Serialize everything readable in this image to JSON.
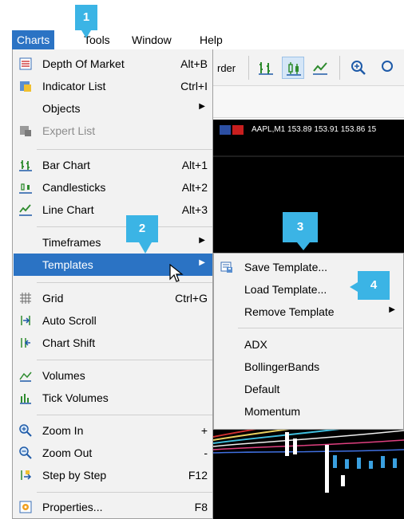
{
  "menubar": {
    "items": [
      "Charts",
      "Tools",
      "Window",
      "Help"
    ]
  },
  "toolbar": {
    "partial_label": "rder"
  },
  "chart": {
    "title": "AAPL,M1  153.89 153.91 153.86 15"
  },
  "charts_menu": {
    "items": [
      {
        "label": "Depth Of Market",
        "shortcut": "Alt+B",
        "icon": "depth-of-market-icon"
      },
      {
        "label": "Indicator List",
        "shortcut": "Ctrl+I",
        "icon": "indicator-list-icon"
      },
      {
        "label": "Objects",
        "submenu": true
      },
      {
        "label": "Expert List",
        "icon": "expert-list-icon",
        "disabled": true
      },
      {
        "label": "Bar Chart",
        "shortcut": "Alt+1",
        "icon": "bar-chart-icon"
      },
      {
        "label": "Candlesticks",
        "shortcut": "Alt+2",
        "icon": "candlesticks-icon"
      },
      {
        "label": "Line Chart",
        "shortcut": "Alt+3",
        "icon": "line-chart-icon"
      },
      {
        "label": "Timeframes",
        "submenu": true
      },
      {
        "label": "Templates",
        "submenu": true,
        "highlighted": true
      },
      {
        "label": "Grid",
        "shortcut": "Ctrl+G",
        "icon": "grid-icon"
      },
      {
        "label": "Auto Scroll",
        "icon": "auto-scroll-icon"
      },
      {
        "label": "Chart Shift",
        "icon": "chart-shift-icon"
      },
      {
        "label": "Volumes",
        "icon": "volumes-icon"
      },
      {
        "label": "Tick Volumes",
        "icon": "tick-volumes-icon"
      },
      {
        "label": "Zoom In",
        "shortcut": "+",
        "icon": "zoom-in-icon"
      },
      {
        "label": "Zoom Out",
        "shortcut": "-",
        "icon": "zoom-out-icon"
      },
      {
        "label": "Step by Step",
        "shortcut": "F12",
        "icon": "step-by-step-icon"
      },
      {
        "label": "Properties...",
        "shortcut": "F8",
        "icon": "properties-icon"
      }
    ]
  },
  "templates_menu": {
    "items": [
      {
        "label": "Save Template...",
        "icon": "save-template-icon"
      },
      {
        "label": "Load Template..."
      },
      {
        "label": "Remove Template",
        "submenu": true
      },
      {
        "label": "ADX"
      },
      {
        "label": "BollingerBands"
      },
      {
        "label": "Default"
      },
      {
        "label": "Momentum"
      }
    ]
  },
  "callouts": [
    "1",
    "2",
    "3",
    "4"
  ],
  "colors": {
    "highlight": "#2b73c4",
    "callout": "#3bb4e5",
    "menu_bg": "#f2f2f2"
  }
}
